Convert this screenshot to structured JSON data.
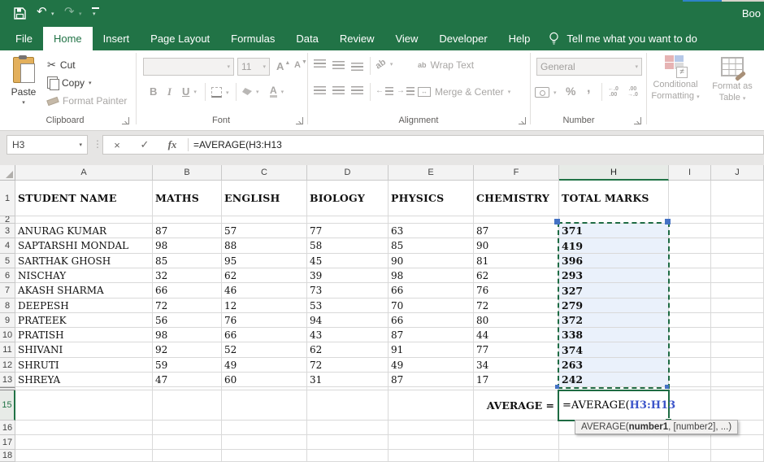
{
  "titlebar": {
    "document_title": "Boo"
  },
  "icons": {
    "dropdown": "▾",
    "undo": "↶",
    "redo": "↷",
    "cut": "✂",
    "cancel": "×",
    "enter": "✓",
    "fx": "fx",
    "dots": "⋮",
    "percent": "%",
    "comma": ",",
    "ab": "ab",
    "inc_dec_top": "←.0",
    "inc_dec_bot": ".00",
    "dec_dec_top": ".00",
    "dec_dec_bot": "→.0",
    "not_equal": "≠",
    "merge_arrows": "↔"
  },
  "tabs": {
    "items": [
      {
        "label": "File",
        "active": false
      },
      {
        "label": "Home",
        "active": true
      },
      {
        "label": "Insert",
        "active": false
      },
      {
        "label": "Page Layout",
        "active": false
      },
      {
        "label": "Formulas",
        "active": false
      },
      {
        "label": "Data",
        "active": false
      },
      {
        "label": "Review",
        "active": false
      },
      {
        "label": "View",
        "active": false
      },
      {
        "label": "Developer",
        "active": false
      },
      {
        "label": "Help",
        "active": false
      }
    ],
    "tell_me": "Tell me what you want to do"
  },
  "ribbon": {
    "clipboard": {
      "group_label": "Clipboard",
      "paste_label": "Paste",
      "cut_label": "Cut",
      "copy_label": "Copy",
      "format_painter_label": "Format Painter"
    },
    "font": {
      "group_label": "Font",
      "size_value": "11",
      "bold": "B",
      "italic": "I",
      "underline": "U",
      "grow_font": "A",
      "shrink_font": "A",
      "font_color": "A"
    },
    "alignment": {
      "group_label": "Alignment",
      "wrap_text": "Wrap Text",
      "merge_center": "Merge & Center"
    },
    "number": {
      "group_label": "Number",
      "format_value": "General"
    },
    "styles": {
      "conditional_line1": "Conditional",
      "conditional_line2": "Formatting",
      "format_table_line1": "Format as",
      "format_table_line2": "Table"
    }
  },
  "formula_bar": {
    "name_box": "H3",
    "formula": "=AVERAGE(H3:H13"
  },
  "sheet": {
    "columns": [
      "A",
      "B",
      "C",
      "D",
      "E",
      "F",
      "H",
      "I",
      "J"
    ],
    "hidden_column": "G",
    "active_column": "H",
    "hidden_row": 14,
    "active_row": 15,
    "header_titles": {
      "A": "STUDENT NAME",
      "B": "MATHS",
      "C": "ENGLISH",
      "D": "BIOLOGY",
      "E": "PHYSICS",
      "F": "CHEMISTRY",
      "H": "TOTAL MARKS"
    },
    "rows": [
      {
        "row": 3,
        "name": "ANURAG KUMAR",
        "marks": [
          87,
          57,
          77,
          63,
          87
        ],
        "total": 371
      },
      {
        "row": 4,
        "name": "SAPTARSHI MONDAL",
        "marks": [
          98,
          88,
          58,
          85,
          90
        ],
        "total": 419
      },
      {
        "row": 5,
        "name": "SARTHAK GHOSH",
        "marks": [
          85,
          95,
          45,
          90,
          81
        ],
        "total": 396
      },
      {
        "row": 6,
        "name": "NISCHAY",
        "marks": [
          32,
          62,
          39,
          98,
          62
        ],
        "total": 293
      },
      {
        "row": 7,
        "name": "AKASH SHARMA",
        "marks": [
          66,
          46,
          73,
          66,
          76
        ],
        "total": 327
      },
      {
        "row": 8,
        "name": "DEEPESH",
        "marks": [
          72,
          12,
          53,
          70,
          72
        ],
        "total": 279
      },
      {
        "row": 9,
        "name": "PRATEEK",
        "marks": [
          56,
          76,
          94,
          66,
          80
        ],
        "total": 372
      },
      {
        "row": 10,
        "name": "PRATISH",
        "marks": [
          98,
          66,
          43,
          87,
          44
        ],
        "total": 338
      },
      {
        "row": 11,
        "name": "SHIVANI",
        "marks": [
          92,
          52,
          62,
          91,
          77
        ],
        "total": 374
      },
      {
        "row": 12,
        "name": "SHRUTI",
        "marks": [
          59,
          49,
          72,
          49,
          34
        ],
        "total": 263
      },
      {
        "row": 13,
        "name": "SHREYA",
        "marks": [
          47,
          60,
          31,
          87,
          17
        ],
        "total": 242
      }
    ],
    "average_label": "AVERAGE =",
    "cell_formula": {
      "prefix": "=AVERAGE(",
      "reference": "H3:H13"
    }
  },
  "tooltip": {
    "prefix": "AVERAGE(",
    "bold": "number1",
    "suffix": ", [number2], ...)"
  },
  "colors": {
    "excel_green": "#217346",
    "selection_fill": "#EAF1FB",
    "reference_blue": "#3B54C9",
    "grid_line": "#D9D9D9",
    "range_border": "#1E6B43",
    "handle_blue": "#4472C4"
  }
}
